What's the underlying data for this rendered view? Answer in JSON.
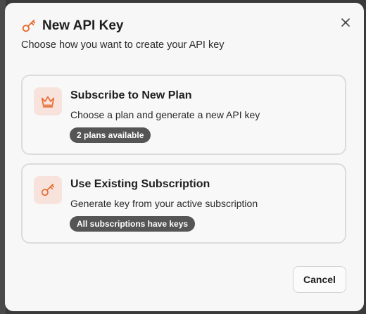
{
  "dialog": {
    "title": "New API Key",
    "subtitle": "Choose how you want to create your API key",
    "title_icon": "key-icon",
    "close_icon": "close-icon"
  },
  "options": [
    {
      "icon": "crown-icon",
      "title": "Subscribe to New Plan",
      "description": "Choose a plan and generate a new API key",
      "badge": "2 plans available"
    },
    {
      "icon": "key-icon",
      "title": "Use Existing Subscription",
      "description": "Generate key from your active subscription",
      "badge": "All subscriptions have keys"
    }
  ],
  "footer": {
    "cancel_label": "Cancel"
  },
  "colors": {
    "accent": "#e8692e",
    "icon_bg": "#f7e3dc",
    "badge_bg": "#555555",
    "dialog_bg": "#f7f7f7",
    "card_border": "#dcdcdc"
  }
}
